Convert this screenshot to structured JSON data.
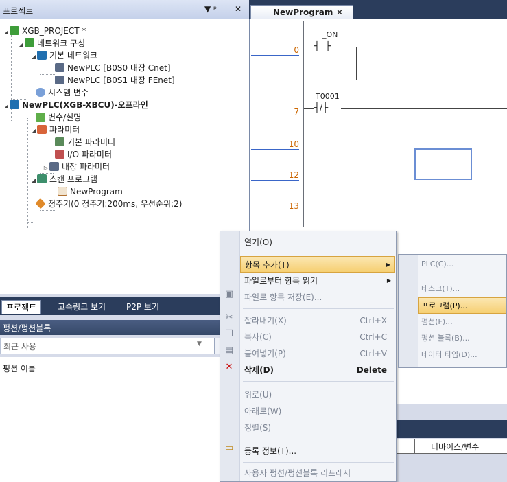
{
  "project_panel": {
    "title": "프로젝트",
    "pin_label": "▼ ᵖ",
    "close_label": "✕",
    "tree": {
      "root": "XGB_PROJECT *",
      "network_config": "네트워크 구성",
      "basic_network": "기본 네트워크",
      "plc_cnet": "NewPLC [B0S0 내장 Cnet]",
      "plc_fenet": "NewPLC [B0S1 내장 FEnet]",
      "system_vars": "시스템 변수",
      "plc_offline": "NewPLC(XGB-XBCU)-오프라인",
      "var_desc": "변수/설명",
      "parameters": "파라미터",
      "basic_params": "기본 파라미터",
      "io_params": "I/O 파라미터",
      "builtin_params": "내장 파라미터",
      "scan_program": "스캔 프로그램",
      "new_program": "NewProgram",
      "periodic": "정주기(0 정주기:200ms, 우선순위:2)"
    }
  },
  "bottom_tabs": [
    "프로젝트",
    "고속링크 보기",
    "P2P 보기"
  ],
  "function_block": {
    "title": "펑션/펑션블록",
    "combo_value": "최근 사용",
    "list_header": "펑션 이름"
  },
  "editor": {
    "tab_label": "NewProgram",
    "tab_close": "✕",
    "row_numbers": [
      "0",
      "7",
      "10",
      "12",
      "13"
    ],
    "contact1": "_ON",
    "contact2": "T0001",
    "var_column_header": "디바이스/변수"
  },
  "context_menu": {
    "items": [
      {
        "label": "열기(O)",
        "shortcut": "",
        "enabled": true
      },
      {
        "label": "항목 추가(T)",
        "shortcut": "",
        "enabled": true,
        "submenu": true
      },
      {
        "label": "파일로부터 항목 읽기",
        "shortcut": "",
        "enabled": true,
        "submenu": true
      },
      {
        "label": "파일로 항목 저장(E)...",
        "shortcut": "",
        "enabled": false
      },
      {
        "label": "잘라내기(X)",
        "shortcut": "Ctrl+X",
        "enabled": false
      },
      {
        "label": "복사(C)",
        "shortcut": "Ctrl+C",
        "enabled": false
      },
      {
        "label": "붙여넣기(P)",
        "shortcut": "Ctrl+V",
        "enabled": false
      },
      {
        "label": "삭제(D)",
        "shortcut": "Delete",
        "enabled": true
      },
      {
        "label": "위로(U)",
        "shortcut": "",
        "enabled": false
      },
      {
        "label": "아래로(W)",
        "shortcut": "",
        "enabled": false
      },
      {
        "label": "정렬(S)",
        "shortcut": "",
        "enabled": false
      },
      {
        "label": "등록 정보(T)...",
        "shortcut": "",
        "enabled": true
      },
      {
        "label": "사용자 펑션/펑션블록 리프레시",
        "shortcut": "",
        "enabled": false
      }
    ]
  },
  "submenu": {
    "items": [
      "PLC(C)...",
      "태스크(T)...",
      "프로그램(P)...",
      "펑션(F)...",
      "펑션 블록(B)...",
      "데이터 타입(D)..."
    ]
  },
  "colors": {
    "accent": "#2b3d5c",
    "highlight": "#f6cf72",
    "row_number": "#cc6600"
  }
}
